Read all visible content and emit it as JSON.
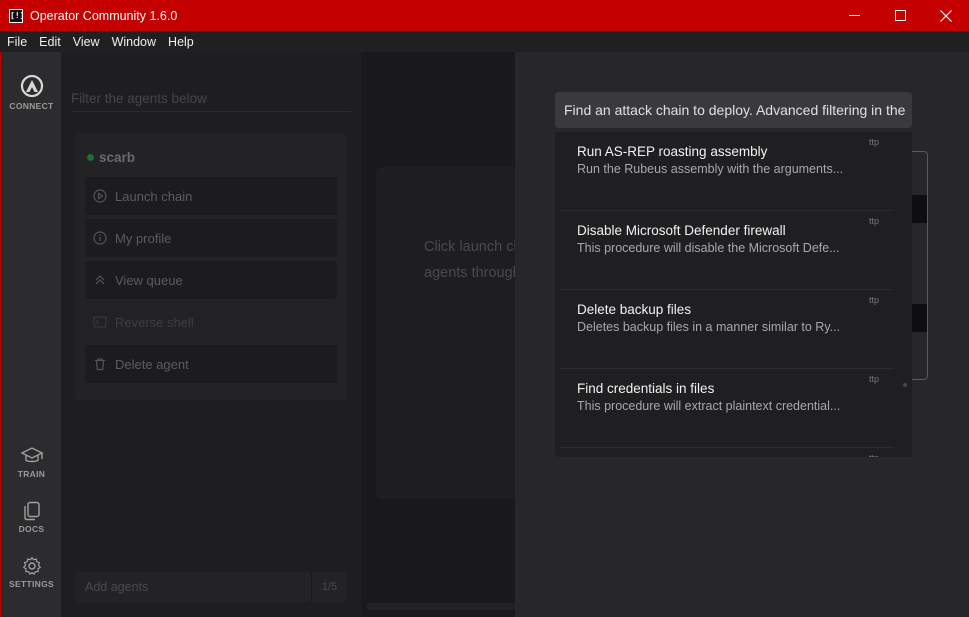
{
  "window": {
    "app_icon_glyph": "[!]",
    "title": "Operator Community 1.6.0"
  },
  "menu": [
    "File",
    "Edit",
    "View",
    "Window",
    "Help"
  ],
  "rail": {
    "connect": "CONNECT",
    "train": "TRAIN",
    "docs": "DOCS",
    "settings": "SETTINGS"
  },
  "agents": {
    "filter_placeholder": "Filter the agents below",
    "agent": {
      "name": "scarb",
      "status_color": "#1b6e2e",
      "actions": [
        {
          "label": "Launch chain",
          "icon": "play-circle-icon"
        },
        {
          "label": "My profile",
          "icon": "info-circle-icon"
        },
        {
          "label": "View queue",
          "icon": "chevrons-up-icon"
        },
        {
          "label": "Reverse shell",
          "icon": "terminal-icon"
        },
        {
          "label": "Delete agent",
          "icon": "trash-icon"
        }
      ]
    },
    "add_placeholder": "Add agents",
    "count": "1/5"
  },
  "main": {
    "hint_line1": "Click launch ch",
    "hint_line2": "agents through"
  },
  "drawer": {
    "search_placeholder": "Find an attack chain to deploy. Advanced filtering in the",
    "results": [
      {
        "title": "Run AS-REP roasting assembly",
        "desc": "Run the Rubeus assembly with the arguments...",
        "tag": "ttp"
      },
      {
        "title": "Disable Microsoft Defender firewall",
        "desc": "This procedure will disable the Microsoft Defe...",
        "tag": "ttp"
      },
      {
        "title": "Delete backup files",
        "desc": "Deletes backup files in a manner similar to Ry...",
        "tag": "ttp"
      },
      {
        "title": "Find credentials in files",
        "desc": "This procedure will extract plaintext credential...",
        "tag": "ttp"
      },
      {
        "title": "",
        "desc": "",
        "tag": "ttp"
      }
    ]
  },
  "colors": {
    "titlebar": "#c40000",
    "accent_status": "#1b6e2e"
  }
}
